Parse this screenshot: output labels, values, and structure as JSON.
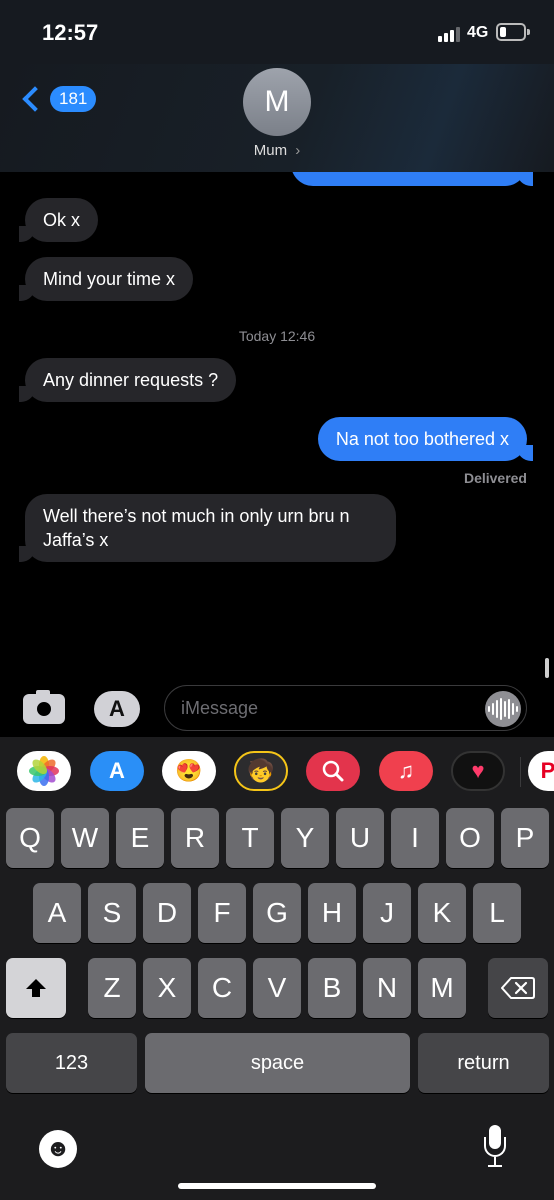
{
  "status_bar": {
    "time": "12:57",
    "network": "4G"
  },
  "header": {
    "back_count": "181",
    "avatar_initial": "M",
    "contact_name": "Mum",
    "contact_chevron": "›"
  },
  "thread": {
    "messages": [
      {
        "from": "them",
        "text": "Ok x"
      },
      {
        "from": "them",
        "text": "Mind your time x"
      },
      {
        "from": "them",
        "text": "Any dinner requests ?"
      },
      {
        "from": "me",
        "text": "Na not too bothered x"
      },
      {
        "from": "them",
        "text": "Well there’s not much in only urn bru n\nJaffa’s x"
      }
    ],
    "timestamp_prefix": "Today",
    "timestamp_time": "12:46",
    "delivery_status": "Delivered"
  },
  "input": {
    "placeholder": "iMessage"
  },
  "app_strip": [
    "photos-icon",
    "app-store-icon",
    "memoji-icon",
    "memoji-stickers-icon",
    "search-images-icon",
    "music-icon",
    "digital-touch-icon",
    "pinterest-icon"
  ],
  "keyboard": {
    "row1": [
      "Q",
      "W",
      "E",
      "R",
      "T",
      "Y",
      "U",
      "I",
      "O",
      "P"
    ],
    "row2": [
      "A",
      "S",
      "D",
      "F",
      "G",
      "H",
      "J",
      "K",
      "L"
    ],
    "row3": [
      "Z",
      "X",
      "C",
      "V",
      "B",
      "N",
      "M"
    ],
    "numbers_label": "123",
    "space_label": "space",
    "return_label": "return"
  },
  "colors": {
    "sent_bubble": "#2f7ef6",
    "received_bubble": "#26262a",
    "accent": "#2b8cff"
  }
}
